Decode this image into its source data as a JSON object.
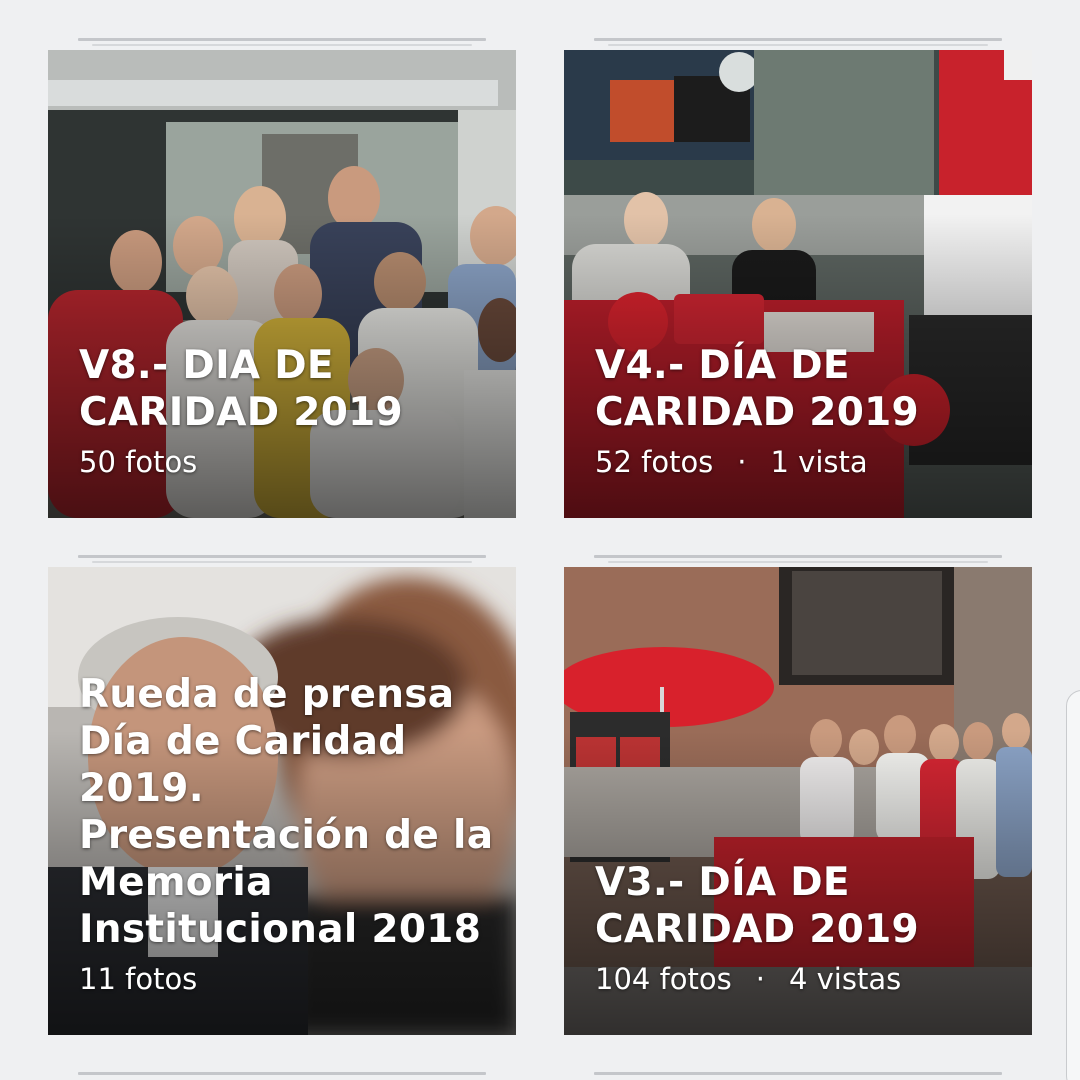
{
  "albums": [
    {
      "title": "V8.- DIA DE\nCARIDAD 2019",
      "photos": "50 fotos",
      "separator": "",
      "views": ""
    },
    {
      "title": "V4.- DÍA DE\nCARIDAD 2019",
      "photos": "52 fotos",
      "separator": "·",
      "views": "1 vista"
    },
    {
      "title": "Rueda de prensa\nDía de Caridad\n2019.\nPresentación de la\nMemoria\nInstitucional 2018",
      "photos": "11 fotos",
      "separator": "",
      "views": ""
    },
    {
      "title": "V3.- DÍA DE\nCARIDAD 2019",
      "photos": "104 fotos",
      "separator": "·",
      "views": "4 vistas"
    }
  ],
  "colors": {
    "background": "#eff0f2",
    "caritas_red": "#c8202f",
    "text": "#ffffff"
  }
}
